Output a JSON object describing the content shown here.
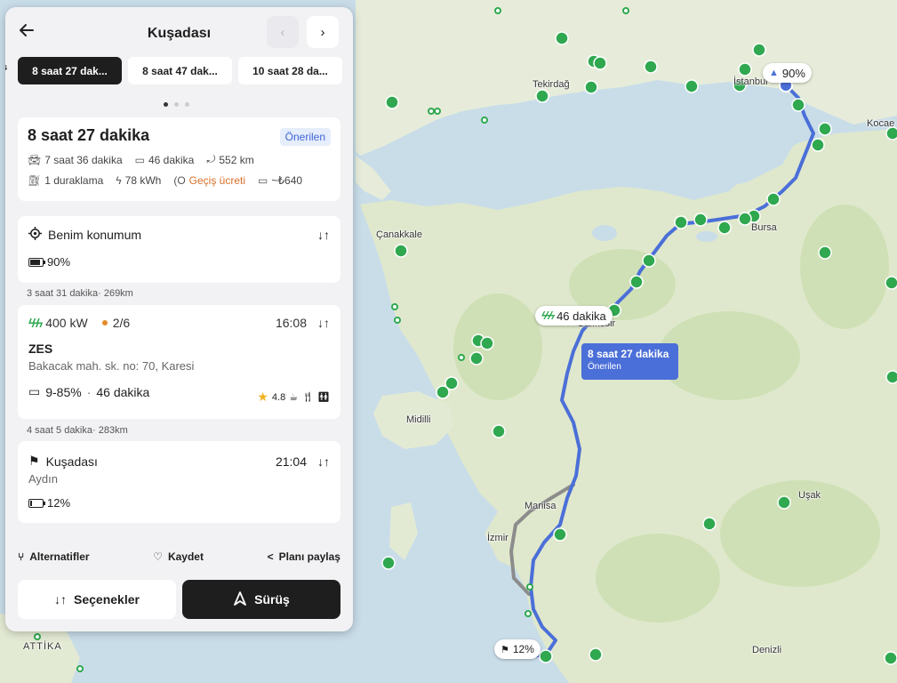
{
  "panel": {
    "title": "Kuşadası",
    "back_icon": "arrow-left-icon",
    "prev_icon": "chevron-left-icon",
    "next_icon": "chevron-right-icon",
    "left_edge_label": "s",
    "route_options": [
      {
        "label": "8 saat 27 dak...",
        "active": true
      },
      {
        "label": "8 saat 47 dak...",
        "active": false
      },
      {
        "label": "10 saat 28 da...",
        "active": false
      }
    ],
    "summary": {
      "duration": "8 saat 27 dakika",
      "badge": "Önerilen",
      "drive_time": "7 saat 36 dakika",
      "charge_time": "46 dakika",
      "distance": "552 km",
      "stops": "1 duraklama",
      "energy": "78 kWh",
      "toll": "Geçiş ücreti",
      "cost": "~₺640"
    },
    "start": {
      "label": "Benim konumum",
      "battery": "90%"
    },
    "leg1": "3 saat 31 dakika· 269km",
    "charger": {
      "power": "400 kW",
      "availability": "2/6",
      "time": "16:08",
      "name": "ZES",
      "address": "Bakacak mah. sk. no: 70, Karesi",
      "charge_range": "9-85%",
      "charge_duration": "46 dakika",
      "rating": "4.8"
    },
    "leg2": "4 saat 5 dakika· 283km",
    "destination": {
      "city": "Kuşadası",
      "time": "21:04",
      "region": "Aydın",
      "battery": "12%"
    },
    "actions": {
      "alternatives": "Alternatifler",
      "save": "Kaydet",
      "share": "Planı paylaş"
    },
    "options_button": "Seçenekler",
    "drive_button": "Sürüş"
  },
  "map": {
    "cities": [
      "İstanbul",
      "Tekirdağ",
      "Kocae",
      "Çanakkale",
      "Bursa",
      "Balıkesir",
      "Midilli",
      "Manisa",
      "İzmir",
      "Uşak",
      "Denizli",
      "ATTİKA"
    ],
    "origin_battery": "90%",
    "charge_stop_label": "46 dakika",
    "route_label": "8 saat 27 dakika",
    "route_label_sub": "Önerilen",
    "destination_battery": "12%",
    "route_color": "#4b6fd8",
    "charger_color": "#2fa84f"
  }
}
